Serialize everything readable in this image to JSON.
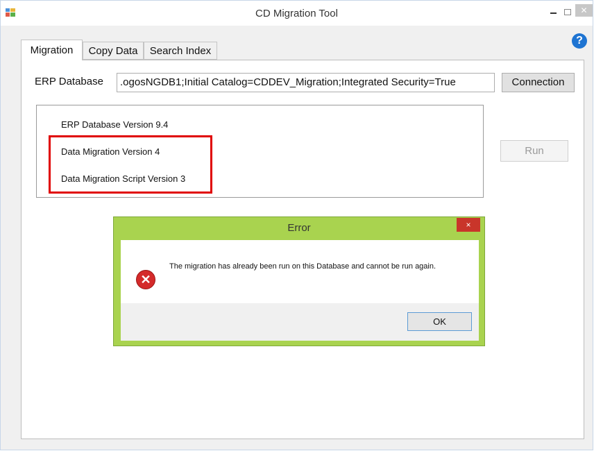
{
  "window": {
    "title": "CD Migration Tool",
    "icons": {
      "app": "app-icon",
      "minimize": "minimize-icon",
      "maximize": "maximize-icon",
      "close": "close-icon",
      "help": "help-icon"
    }
  },
  "tabs": [
    {
      "label": "Migration",
      "active": true
    },
    {
      "label": "Copy Data",
      "active": false
    },
    {
      "label": "Search Index",
      "active": false
    }
  ],
  "migration": {
    "erp_label": "ERP Database",
    "connection_value": ".ogosNGDB1;Initial Catalog=CDDEV_Migration;Integrated Security=True",
    "connection_button": "Connection",
    "info_lines": [
      "ERP Database Version 9.4",
      "Data Migration Version 4",
      "Data Migration Script Version 3"
    ],
    "run_button": "Run",
    "run_enabled": false
  },
  "dialog": {
    "title": "Error",
    "message": "The migration has already been run on this Database and cannot be run again.",
    "ok_button": "OK",
    "close_symbol": "×",
    "icon": "error-icon",
    "accent_color": "#a9d34f"
  },
  "colors": {
    "highlight_border": "#e00000",
    "help_icon": "#1e74d2",
    "error_icon": "#d42a2a"
  }
}
